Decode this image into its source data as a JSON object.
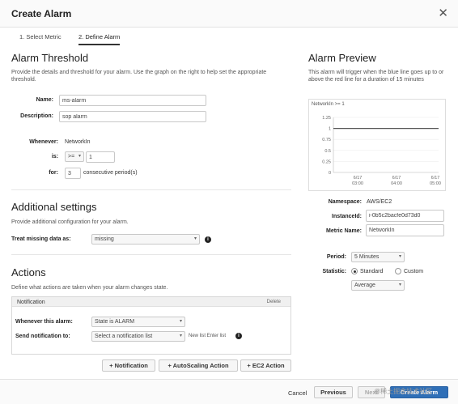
{
  "dialog": {
    "title": "Create Alarm"
  },
  "steps": [
    "1. Select Metric",
    "2. Define Alarm"
  ],
  "threshold": {
    "heading": "Alarm Threshold",
    "help": "Provide the details and threshold for your alarm. Use the graph on the right to help set the appropriate threshold.",
    "name_label": "Name:",
    "name_value": "ms-alarm",
    "description_label": "Description:",
    "description_value": "sop alarm",
    "whenever_label": "Whenever:",
    "whenever_value": "NetworkIn",
    "is_label": "is:",
    "operator_value": ">=",
    "threshold_value": "1",
    "for_label": "for:",
    "for_value": "3",
    "periods_text": "consecutive period(s)"
  },
  "additional": {
    "heading": "Additional settings",
    "help": "Provide additional configuration for your alarm.",
    "missing_label": "Treat missing data as:",
    "missing_value": "missing"
  },
  "actions": {
    "heading": "Actions",
    "help": "Define what actions are taken when your alarm changes state.",
    "panel_title": "Notification",
    "panel_delete": "Delete",
    "whenever_label": "Whenever this alarm:",
    "state_value": "State is ALARM",
    "send_label": "Send notification to:",
    "send_value": "Select a notification list",
    "new_list_text": "New list  Enter list",
    "buttons": [
      "+ Notification",
      "+ AutoScaling Action",
      "+ EC2 Action"
    ]
  },
  "preview": {
    "heading": "Alarm Preview",
    "help": "This alarm will trigger when the blue line goes up to or above the red line for a duration of 15 minutes",
    "namespace_label": "Namespace:",
    "namespace_value": "AWS/EC2",
    "instance_label": "InstanceId:",
    "instance_value": "i-0b5c2bacfe0d73d0",
    "metric_label": "Metric Name:",
    "metric_value": "NetworkIn",
    "period_label": "Period:",
    "period_value": "5 Minutes",
    "statistic_label": "Statistic:",
    "standard_label": "Standard",
    "custom_label": "Custom",
    "stat_value": "Average"
  },
  "chart_data": {
    "type": "line",
    "title": "NetworkIn >= 1",
    "yticks": [
      "1.25",
      "1",
      "0.75",
      "0.5",
      "0.25",
      "0"
    ],
    "xticks": [
      {
        "date": "6/17",
        "time": "03:00"
      },
      {
        "date": "6/17",
        "time": "04:00"
      },
      {
        "date": "6/17",
        "time": "05:00"
      }
    ],
    "threshold": 1,
    "ylim": [
      0,
      1.25
    ]
  },
  "footer": {
    "cancel": "Cancel",
    "previous": "Previous",
    "next": "Next",
    "create": "Create Alarm"
  },
  "watermark": "@稀土掘金技术社区"
}
